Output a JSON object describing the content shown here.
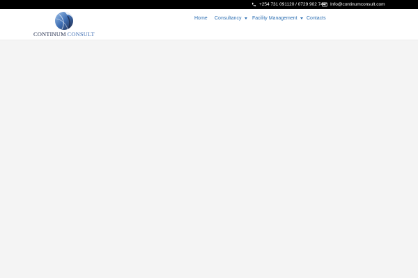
{
  "topbar": {
    "phone_icon": "phone-icon",
    "phone": "+254 731 091120 / 0729 902 744",
    "email_icon": "envelope-icon",
    "email": "Info@continumconsult.com"
  },
  "logo": {
    "word1": "CONTINUM",
    "word2": "CONSULT",
    "colors": {
      "primary": "#1e2a4a",
      "accent": "#3f6fb4"
    }
  },
  "nav": {
    "items": [
      {
        "label": "Home",
        "has_dropdown": false
      },
      {
        "label": "Consultancy",
        "has_dropdown": true
      },
      {
        "label": "Facility Management",
        "has_dropdown": true
      },
      {
        "label": "Contacts",
        "has_dropdown": false
      }
    ],
    "link_color": "#2c6fb3"
  },
  "theme": {
    "topbar_bg": "#000000",
    "header_bg": "#ffffff",
    "content_bg": "#f4f4f4"
  }
}
